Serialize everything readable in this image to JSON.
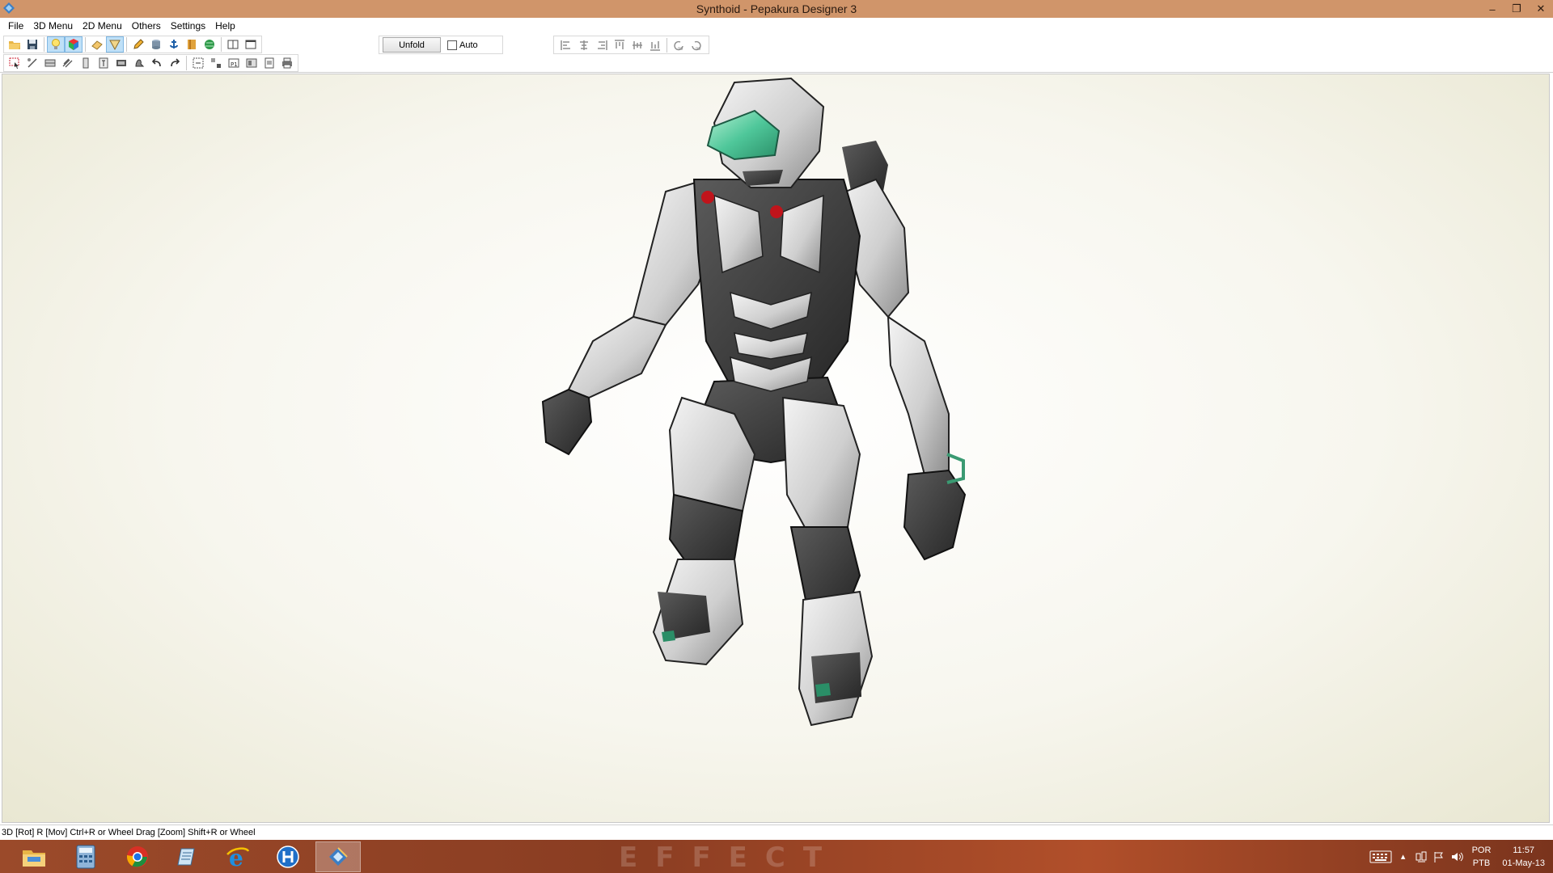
{
  "window": {
    "title": "Synthoid - Pepakura Designer 3",
    "controls": {
      "minimize": "–",
      "restore": "❐",
      "close": "✕"
    }
  },
  "menu": [
    "File",
    "3D Menu",
    "2D Menu",
    "Others",
    "Settings",
    "Help"
  ],
  "toolbar": {
    "unfold_label": "Unfold",
    "auto_label": "Auto",
    "auto_checked": false
  },
  "status": {
    "text": "3D [Rot] R [Mov] Ctrl+R or Wheel Drag [Zoom] Shift+R or Wheel"
  },
  "taskbar": {
    "wallpaper_text": "EFFECT",
    "apps": [
      "file-explorer",
      "calculator",
      "chrome",
      "notepad",
      "internet-explorer",
      "h-app",
      "pepakura"
    ],
    "active_app": "pepakura",
    "language": {
      "line1": "POR",
      "line2": "PTB"
    },
    "clock": {
      "time": "11:57",
      "date": "01-May-13"
    }
  },
  "colors": {
    "titlebar": "#d0956a",
    "taskbar": "#9b4a2a",
    "visor": "#4fc79a",
    "eyes": "#c0141b"
  }
}
